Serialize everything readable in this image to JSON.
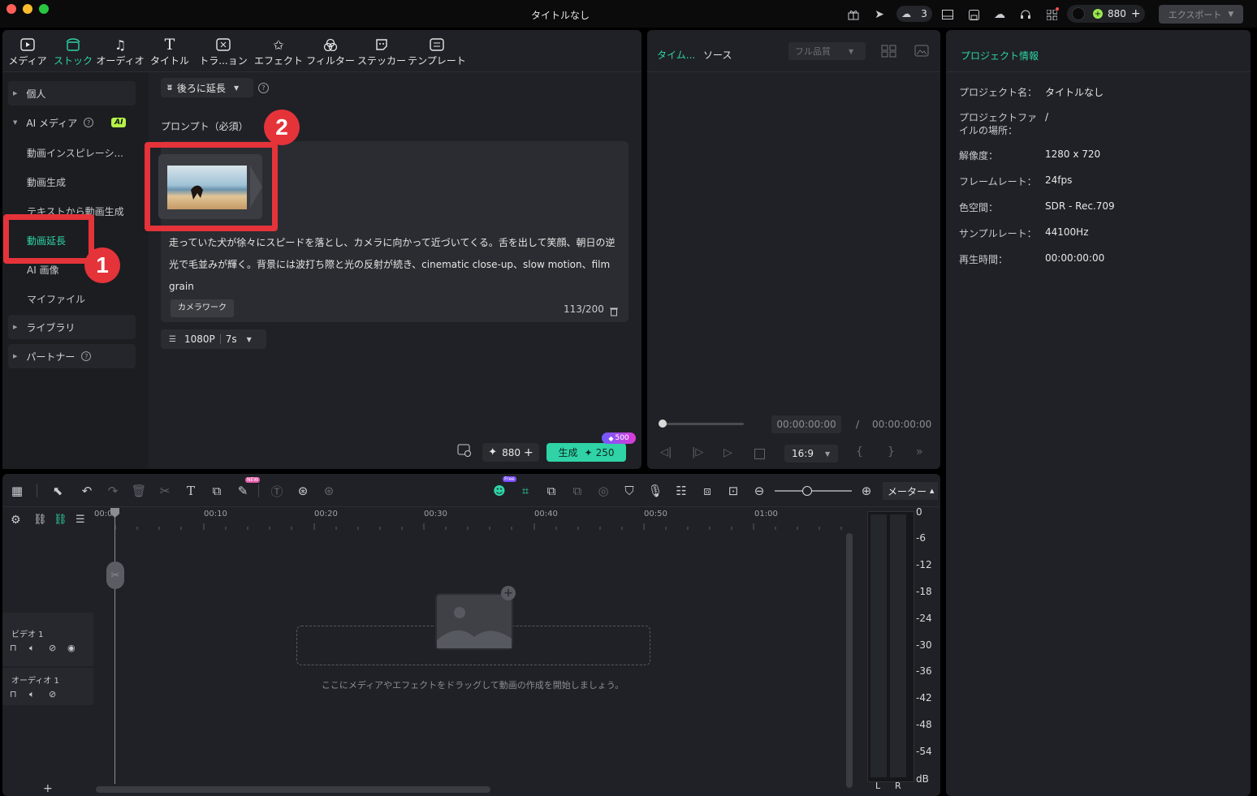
{
  "window": {
    "title": "タイトルなし"
  },
  "titlebar": {
    "notifications_count": "3",
    "credits": "880",
    "export_label": "エクスポート"
  },
  "tabs": [
    {
      "label": "メディア",
      "icon": "media-icon"
    },
    {
      "label": "ストック",
      "icon": "stock-icon"
    },
    {
      "label": "オーディオ",
      "icon": "audio-icon"
    },
    {
      "label": "タイトル",
      "icon": "title-icon"
    },
    {
      "label": "トラ...ョン",
      "icon": "transition-icon"
    },
    {
      "label": "エフェクト",
      "icon": "effect-icon"
    },
    {
      "label": "フィルター",
      "icon": "filter-icon"
    },
    {
      "label": "ステッカー",
      "icon": "sticker-icon"
    },
    {
      "label": "テンプレート",
      "icon": "template-icon"
    }
  ],
  "sidebar": {
    "personal": "個人",
    "ai_media": "AI メディア",
    "ai_badge": "AI",
    "items": [
      "動画インスピレーシ...",
      "動画生成",
      "テキストから動画生成",
      "動画延長",
      "AI 画像",
      "マイファイル"
    ],
    "library": "ライブラリ",
    "partner": "パートナー"
  },
  "extend": {
    "mode_label": "後ろに延長",
    "prompt_label": "プロンプト（必須）",
    "prompt_text": "走っていた犬が徐々にスピードを落とし、カメラに向かって近づいてくる。舌を出して笑顔、朝日の逆光で毛並みが輝く。背景には波打ち際と光の反射が続き、cinematic close-up、slow motion、film grain",
    "camera_chip": "カメラワーク",
    "char_count": "113/200",
    "resolution": "1080P",
    "duration": "7s",
    "credits": "880",
    "generate_label": "生成",
    "generate_cost": "250",
    "promo_badge": "500"
  },
  "preview": {
    "tab_timeline": "タイム...",
    "tab_source": "ソース",
    "quality": "フル品質",
    "current_time": "00:00:00:00",
    "separator": "/",
    "total_time": "00:00:00:00",
    "aspect": "16:9"
  },
  "project_info": {
    "title": "プロジェクト情報",
    "rows": [
      {
        "label": "プロジェクト名：",
        "value": "タイトルなし"
      },
      {
        "label": "プロジェクトファイルの場所：",
        "value": "/"
      },
      {
        "label": "解像度：",
        "value": "1280 x 720"
      },
      {
        "label": "フレームレート：",
        "value": "24fps"
      },
      {
        "label": "色空間：",
        "value": "SDR - Rec.709"
      },
      {
        "label": "サンプルレート：",
        "value": "44100Hz"
      },
      {
        "label": "再生時間：",
        "value": "00:00:00:00"
      }
    ]
  },
  "timeline": {
    "meter_label": "メーター",
    "ruler": [
      "00:00",
      "00:10",
      "00:20",
      "00:30",
      "00:40",
      "00:50",
      "01:00"
    ],
    "tracks": [
      {
        "name": "ビデオ 1"
      },
      {
        "name": "オーディオ 1"
      }
    ],
    "drop_hint": "ここにメディアやエフェクトをドラッグして動画の作成を開始しましょう。",
    "db_scale": [
      "0",
      "-6",
      "-12",
      "-18",
      "-24",
      "-30",
      "-36",
      "-42",
      "-48",
      "-54",
      "dB"
    ],
    "lr": [
      "L",
      "R"
    ],
    "free_badge": "Free",
    "new_badge": "NEW"
  },
  "annotations": [
    "1",
    "2"
  ],
  "colors": {
    "accent": "#2fd3a6",
    "highlight": "#e5333a",
    "panel": "#1f2126"
  }
}
